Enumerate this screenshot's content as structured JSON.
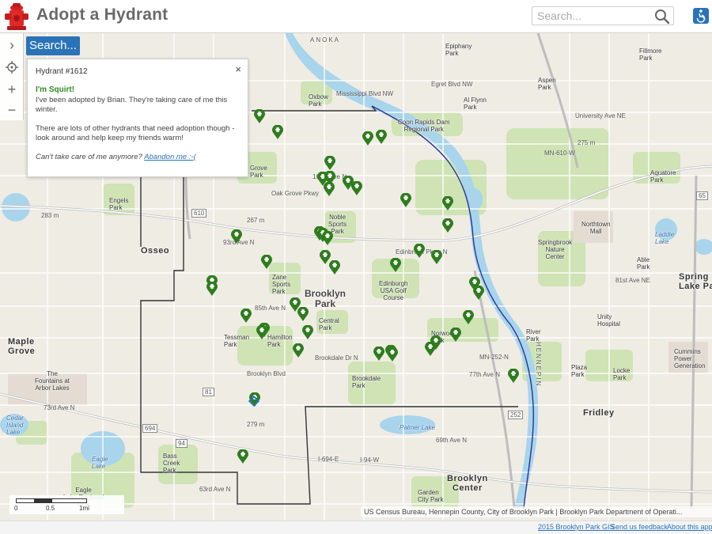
{
  "header": {
    "title": "Adopt a Hydrant",
    "search_placeholder": "Search..."
  },
  "controls": {
    "expand": "›",
    "zoom_in": "+",
    "zoom_out": "−",
    "search_button": "Search..."
  },
  "popup": {
    "title": "Hydrant #1612",
    "close": "×",
    "heading": "I'm Squirt!",
    "line1": "I've been adopted by Brian. They're taking care of me this winter.",
    "line2": "There are lots of other hydrants that need adoption though - look around and help keep my friends warm!",
    "question": "Can't take care of me anymore?",
    "abandon_link": "Abandon me :-("
  },
  "map_labels": {
    "brooklyn_park": "Brooklyn\nPark",
    "osseo": "Osseo",
    "maple_grove": "Maple\nGrove",
    "fridley": "Fridley",
    "brooklyn_center": "Brooklyn\nCenter",
    "spring_lake_park": "Spring\nLake Park",
    "coon_rapids_dam": "Coon Rapids Dam\nRegional Park",
    "oxbow_park": "Oxbow\nPark",
    "noble_sports_park": "Noble\nSports\nPark",
    "zane_sports_park": "Zane\nSports\nPark",
    "edinburgh": "Edinburgh\nUSA Golf\nCourse",
    "central_park": "Central\nPark",
    "norwood_park": "Norwood\nPark",
    "brookdale_park": "Brookdale\nPark",
    "tessman_park": "Tessman\nPark",
    "hamilton_park": "Hamilton\nPark",
    "river_park": "River\nPark",
    "upsala_hospital": "Unity\nHospital",
    "springbrook": "Springbrook\nNature\nCenter",
    "northtown_mall": "Northtown\nMall",
    "locke_park": "Locke\nPark",
    "plaza_park": "Plaza\nPark",
    "cummins": "Cummins\nPower\nGeneration",
    "arbor_lakes": "The\nFountains at\nArbor Lakes",
    "palmer_lake": "Palmer Lake",
    "eagle_lake": "Eagle\nLake",
    "eagle_lake_regional": "Eagle\nLake Regional\nPark",
    "bass_creek_park": "Bass\nCreek\nPark",
    "engels_park": "Engels\nPark",
    "cedar_island": "Cedar\nIsland\nLake",
    "epiphany_park": "Epiphany\nPark",
    "al_flynn_park": "Al Flynn\nPark",
    "aspen_park": "Aspen\nPark",
    "filmore_park": "Fillmore\nPark",
    "aquatore_park": "Aquatore\nPark",
    "laddie_lake": "Laddie\nLake",
    "able_park": "Able\nPark",
    "garden_city_park": "Garden\nCity Park",
    "grove_park": "Grove\nPark",
    "hennepin": "HENNEPIN",
    "anoka": "ANOKA"
  },
  "road_labels": {
    "mississippi_blvd": "Mississippi Blvd NW",
    "egret_blvd": "Egret Blvd NW",
    "ave_101": "101st Ave N",
    "oak_grove": "Oak Grove Pkwy",
    "ave_93": "93rd Ave N",
    "ave_85": "85th Ave N",
    "brooklyn_blvd": "Brooklyn Blvd",
    "brookdale_dr": "Brookdale Dr N",
    "ave_77": "77th Ave N",
    "ave_73": "73rd Ave N",
    "ave_69": "69th Ave N",
    "ave_63": "63rd Ave N",
    "i694": "I-694-E",
    "i94": "I-94-W",
    "mn610": "MN-610-W",
    "edinbrook": "Edinbrook Pkwy N",
    "ave_81": "81st Ave NE",
    "univ_ave": "University Ave NE",
    "r252": "MN-252-N",
    "r283": "283 m",
    "r267": "267 m",
    "r275": "275 m",
    "r279": "279 m",
    "r610": "610",
    "r81": "81",
    "r94": "94",
    "r694": "694",
    "r252b": "252",
    "r65": "65"
  },
  "scale": {
    "zero": "0",
    "half": "0.5",
    "one": "1mi"
  },
  "attribution": "US Census Bureau, Hennepin County, City of Brooklyn Park | Brooklyn Park Department of Operati...",
  "footer": {
    "gis": "2015 Brooklyn Park GIS",
    "feedback": "Send us feedback",
    "about": "About this app"
  },
  "colors": {
    "pin_green": "#2e7d1e",
    "accent_blue": "#2a73b8",
    "park_green": "#cfe3b4",
    "water_blue": "#a8d4ec",
    "road": "#ffffff",
    "highway": "#f4ecd6"
  }
}
